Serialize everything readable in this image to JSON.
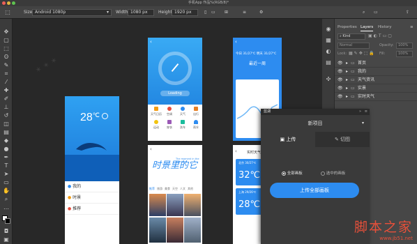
{
  "window": {
    "title": "手机App 作品%(RGB/8)*"
  },
  "options": {
    "size_label": "Size:",
    "size_value": "Android 1080p",
    "width_label": "Width:",
    "width_value": "1080 px",
    "height_label": "Height:",
    "height_value": "1920 px"
  },
  "layers_panel": {
    "tab_properties": "Properties",
    "tab_layers": "Layers",
    "tab_history": "History",
    "filter_kind": "Kind",
    "blend_mode": "Normal",
    "opacity_label": "Opacity:",
    "opacity_value": "100%",
    "lock_label": "Lock:",
    "fill_label": "Fill:",
    "fill_value": "100%",
    "layers": [
      "首页",
      "我的",
      "天气资讯",
      "实景",
      "实时天气"
    ]
  },
  "artboard_home": {
    "temp": "28",
    "unit": "℃",
    "menu": [
      "我的",
      "时景",
      "推荐"
    ]
  },
  "artboard_gauge": {
    "btn": "Loading",
    "grid": [
      "天气日历",
      "空调",
      "天气",
      "出行",
      "运动",
      "穿衣",
      "洗车",
      "雨伞"
    ]
  },
  "artboard_week": {
    "title": "最近一周",
    "dates": "今日 31/27℃",
    "dates2": "明天 31/27℃"
  },
  "artboard_scenic": {
    "title_big": "时景里的它",
    "sub": "The moment in the Nowhere",
    "tabs": [
      "推荐",
      "旅游",
      "美食",
      "天空",
      "人文",
      "其他"
    ]
  },
  "artboard_realtime": {
    "title": "实时天气",
    "card1_temp": "32℃",
    "card1_city": "北京 30/27℃",
    "card2_temp": "28℃",
    "card2_city": "上海 29/26℃"
  },
  "plugin": {
    "brand": "蓝湖",
    "project": "新项目",
    "tab_upload": "上传",
    "tab_slice": "切图",
    "opt_all": "全部画板",
    "opt_selected": "选中的画板",
    "upload_button": "上传全部画板",
    "accent": "#2d8cf0"
  },
  "watermark": {
    "big": "脚本之家",
    "url": "www.jb51.net"
  }
}
